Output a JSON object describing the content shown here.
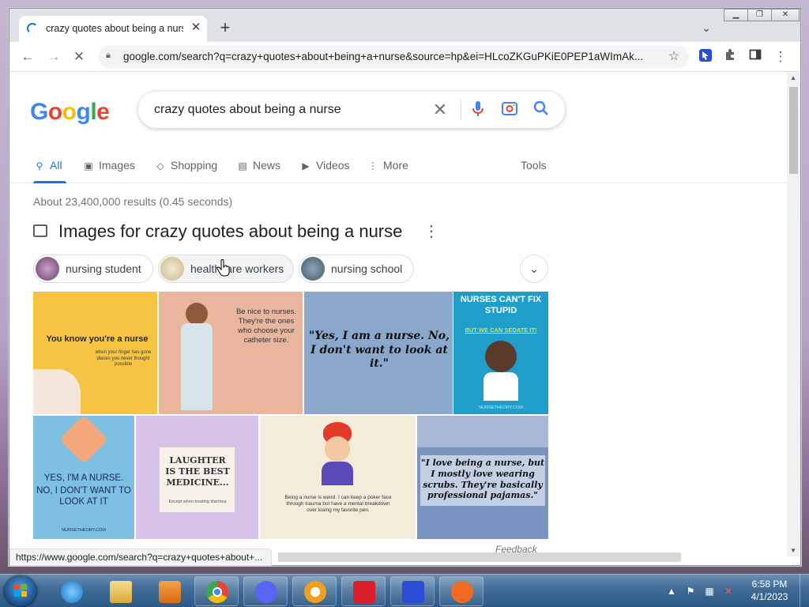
{
  "browser": {
    "tab_title": "crazy quotes about being a nurse",
    "url": "google.com/search?q=crazy+quotes+about+being+a+nurse&source=hp&ei=HLcoZKGuPKiE0PEP1aWImAk...",
    "status_url": "https://www.google.com/search?q=crazy+quotes+about+..."
  },
  "google": {
    "logo": "Google",
    "query": "crazy quotes about being a nurse",
    "tabs": [
      {
        "label": "All"
      },
      {
        "label": "Images"
      },
      {
        "label": "Shopping"
      },
      {
        "label": "News"
      },
      {
        "label": "Videos"
      },
      {
        "label": "More"
      }
    ],
    "tools": "Tools",
    "stats": "About 23,400,000 results (0.45 seconds)",
    "images_heading": "Images for crazy quotes about being a nurse",
    "chips": [
      "nursing student",
      "healthcare workers",
      "nursing school"
    ],
    "images": [
      {
        "caption": "You know you're a nurse",
        "sub": "when your finger has gone places you never thought possible",
        "bg": "#f6c343"
      },
      {
        "caption": "Be nice to nurses. They're the ones who choose your catheter size.",
        "bg": "#e9b59d"
      },
      {
        "caption": "\"Yes, I am a nurse. No, I don't want to look at it.\"",
        "bg": "#8aa8cc"
      },
      {
        "caption": "NURSES CAN'T FIX STUPID",
        "sub": "BUT WE CAN SEDATE IT!",
        "footer": "NURSETHEORY.COM",
        "bg": "#1f9ec9"
      },
      {
        "caption": "YES, I'M A NURSE.",
        "sub": "NO, I DON'T WANT TO LOOK AT IT",
        "footer": "NURSETHEORY.COM",
        "bg": "#7ec0e2"
      },
      {
        "caption": "LAUGHTER IS THE BEST MEDICINE...",
        "sub": "Except when treating diarrhea",
        "bg": "#d7c3ea"
      },
      {
        "caption": "Being a nurse is weird. I can keep a poker face through trauma but have a mental breakdown over losing my favorite pen.",
        "bg": "#f3ecdb"
      },
      {
        "caption": "\"I love being a nurse, but I mostly love wearing scrubs. They're basically professional pajamas.\"",
        "bg": "#7a94c2"
      }
    ],
    "feedback": "Feedback"
  },
  "taskbar": {
    "time": "6:58 PM",
    "date": "4/1/2023"
  }
}
